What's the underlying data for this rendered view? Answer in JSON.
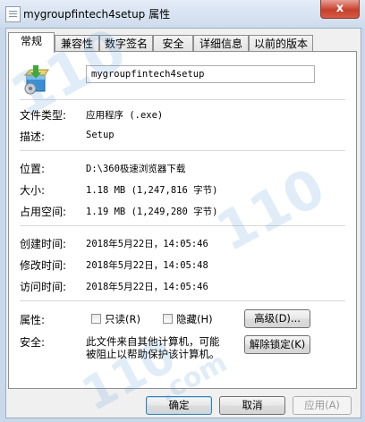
{
  "window": {
    "title": "mygroupfintech4setup 属性",
    "close_label": "x"
  },
  "tabs": [
    {
      "label": "常规",
      "active": true
    },
    {
      "label": "兼容性"
    },
    {
      "label": "数字签名"
    },
    {
      "label": "安全"
    },
    {
      "label": "详细信息"
    },
    {
      "label": "以前的版本"
    }
  ],
  "file": {
    "name": "mygroupfintech4setup",
    "icon": "setup-package-icon"
  },
  "props": {
    "type_label": "文件类型:",
    "type_value": "应用程序 (.exe)",
    "desc_label": "描述:",
    "desc_value": "Setup",
    "location_label": "位置:",
    "location_value": "D:\\360极速浏览器下载",
    "size_label": "大小:",
    "size_value": "1.18 MB (1,247,816 字节)",
    "disk_label": "占用空间:",
    "disk_value": "1.19 MB (1,249,280 字节)",
    "created_label": "创建时间:",
    "created_value": "2018年5月22日，14:05:46",
    "modified_label": "修改时间:",
    "modified_value": "2018年5月22日，14:05:48",
    "accessed_label": "访问时间:",
    "accessed_value": "2018年5月22日，14:05:46",
    "attr_label": "属性:",
    "readonly_label": "只读(R)",
    "hidden_label": "隐藏(H)",
    "advanced_label": "高级(D)...",
    "security_label": "安全:",
    "security_line1": "此文件来自其他计算机，可能",
    "security_line2": "被阻止以帮助保护该计算机。",
    "unblock_label": "解除锁定(K)"
  },
  "footer": {
    "ok": "确定",
    "cancel": "取消",
    "apply": "应用(A)"
  },
  "watermark": {
    "text1": "110",
    "text2": ".com"
  },
  "colors": {
    "titlebar": "#cfdcec",
    "close": "#c7402c",
    "panel": "#ffffff",
    "dialog": "#f0f0f0"
  }
}
